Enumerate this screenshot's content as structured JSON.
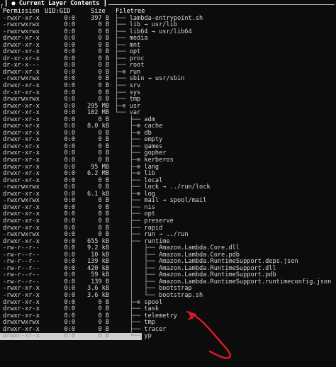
{
  "panel": {
    "title": "Current Layer Contents"
  },
  "columns": {
    "permission": "Permission",
    "uid_gid": "UID:GID",
    "size": "Size",
    "filetree": "Filetree"
  },
  "rows": [
    {
      "perm": "-rwxr-xr-x",
      "uid": "0:0",
      "size": "397 B",
      "tree": "├── ",
      "name": "lambda-entrypoint.sh"
    },
    {
      "perm": "-rwxrwxrwx",
      "uid": "0:0",
      "size": "0 B",
      "tree": "├── ",
      "name": "lib → usr/lib"
    },
    {
      "perm": "-rwxrwxrwx",
      "uid": "0:0",
      "size": "0 B",
      "tree": "├── ",
      "name": "lib64 → usr/lib64"
    },
    {
      "perm": "drwxr-xr-x",
      "uid": "0:0",
      "size": "0 B",
      "tree": "├── ",
      "name": "media"
    },
    {
      "perm": "drwxr-xr-x",
      "uid": "0:0",
      "size": "0 B",
      "tree": "├── ",
      "name": "mnt"
    },
    {
      "perm": "drwxr-xr-x",
      "uid": "0:0",
      "size": "0 B",
      "tree": "├── ",
      "name": "opt"
    },
    {
      "perm": "dr-xr-xr-x",
      "uid": "0:0",
      "size": "0 B",
      "tree": "├── ",
      "name": "proc"
    },
    {
      "perm": "dr-xr-x---",
      "uid": "0:0",
      "size": "0 B",
      "tree": "├── ",
      "name": "root"
    },
    {
      "perm": "drwxr-xr-x",
      "uid": "0:0",
      "size": "0 B",
      "tree": "├─⊕ ",
      "name": "run"
    },
    {
      "perm": "-rwxrwxrwx",
      "uid": "0:0",
      "size": "0 B",
      "tree": "├── ",
      "name": "sbin → usr/sbin"
    },
    {
      "perm": "drwxr-xr-x",
      "uid": "0:0",
      "size": "0 B",
      "tree": "├── ",
      "name": "srv"
    },
    {
      "perm": "dr-xr-xr-x",
      "uid": "0:0",
      "size": "0 B",
      "tree": "├── ",
      "name": "sys"
    },
    {
      "perm": "drwxrwxrwx",
      "uid": "0:0",
      "size": "0 B",
      "tree": "├── ",
      "name": "tmp"
    },
    {
      "perm": "drwxr-xr-x",
      "uid": "0:0",
      "size": "295 MB",
      "tree": "├─⊕ ",
      "name": "usr"
    },
    {
      "perm": "drwxr-xr-x",
      "uid": "0:0",
      "size": "102 MB",
      "tree": "└── ",
      "name": "var"
    },
    {
      "perm": "drwxr-xr-x",
      "uid": "0:0",
      "size": "0 B",
      "tree": "    ├── ",
      "name": "adm"
    },
    {
      "perm": "drwxr-xr-x",
      "uid": "0:0",
      "size": "8.0 kB",
      "tree": "    ├─⊕ ",
      "name": "cache"
    },
    {
      "perm": "drwxr-xr-x",
      "uid": "0:0",
      "size": "0 B",
      "tree": "    ├─⊕ ",
      "name": "db"
    },
    {
      "perm": "drwxr-xr-x",
      "uid": "0:0",
      "size": "0 B",
      "tree": "    ├── ",
      "name": "empty"
    },
    {
      "perm": "drwxr-xr-x",
      "uid": "0:0",
      "size": "0 B",
      "tree": "    ├── ",
      "name": "games"
    },
    {
      "perm": "drwxr-xr-x",
      "uid": "0:0",
      "size": "0 B",
      "tree": "    ├── ",
      "name": "gopher"
    },
    {
      "perm": "drwxr-xr-x",
      "uid": "0:0",
      "size": "0 B",
      "tree": "    ├─⊕ ",
      "name": "kerberos"
    },
    {
      "perm": "drwxr-xr-x",
      "uid": "0:0",
      "size": "95 MB",
      "tree": "    ├─⊕ ",
      "name": "lang"
    },
    {
      "perm": "drwxr-xr-x",
      "uid": "0:0",
      "size": "6.2 MB",
      "tree": "    ├─⊕ ",
      "name": "lib"
    },
    {
      "perm": "drwxr-xr-x",
      "uid": "0:0",
      "size": "0 B",
      "tree": "    ├── ",
      "name": "local"
    },
    {
      "perm": "-rwxrwxrwx",
      "uid": "0:0",
      "size": "0 B",
      "tree": "    ├── ",
      "name": "lock → ../run/lock"
    },
    {
      "perm": "drwxr-xr-x",
      "uid": "0:0",
      "size": "6.1 kB",
      "tree": "    ├─⊕ ",
      "name": "log"
    },
    {
      "perm": "-rwxrwxrwx",
      "uid": "0:0",
      "size": "0 B",
      "tree": "    ├── ",
      "name": "mail → spool/mail"
    },
    {
      "perm": "drwxr-xr-x",
      "uid": "0:0",
      "size": "0 B",
      "tree": "    ├── ",
      "name": "nis"
    },
    {
      "perm": "drwxr-xr-x",
      "uid": "0:0",
      "size": "0 B",
      "tree": "    ├── ",
      "name": "opt"
    },
    {
      "perm": "drwxr-xr-x",
      "uid": "0:0",
      "size": "0 B",
      "tree": "    ├── ",
      "name": "preserve"
    },
    {
      "perm": "drwxr-xr-x",
      "uid": "0:0",
      "size": "0 B",
      "tree": "    ├── ",
      "name": "rapid"
    },
    {
      "perm": "-rwxrwxrwx",
      "uid": "0:0",
      "size": "0 B",
      "tree": "    ├── ",
      "name": "run → ../run"
    },
    {
      "perm": "drwxr-xr-x",
      "uid": "0:0",
      "size": "655 kB",
      "tree": "    ├── ",
      "name": "runtime"
    },
    {
      "perm": "-rw-r--r--",
      "uid": "0:0",
      "size": "9.2 kB",
      "tree": "    │   ├── ",
      "name": "Amazon.Lambda.Core.dll"
    },
    {
      "perm": "-rw-r--r--",
      "uid": "0:0",
      "size": "10 kB",
      "tree": "    │   ├── ",
      "name": "Amazon.Lambda.Core.pdb"
    },
    {
      "perm": "-rw-r--r--",
      "uid": "0:0",
      "size": "139 kB",
      "tree": "    │   ├── ",
      "name": "Amazon.Lambda.RuntimeSupport.deps.json"
    },
    {
      "perm": "-rw-r--r--",
      "uid": "0:0",
      "size": "420 kB",
      "tree": "    │   ├── ",
      "name": "Amazon.Lambda.RuntimeSupport.dll"
    },
    {
      "perm": "-rw-r--r--",
      "uid": "0:0",
      "size": "59 kB",
      "tree": "    │   ├── ",
      "name": "Amazon.Lambda.RuntimeSupport.pdb"
    },
    {
      "perm": "-rw-r--r--",
      "uid": "0:0",
      "size": "139 B",
      "tree": "    │   ├── ",
      "name": "Amazon.Lambda.RuntimeSupport.runtimeconfig.json"
    },
    {
      "perm": "-rwxr-xr-x",
      "uid": "0:0",
      "size": "3.6 kB",
      "tree": "    │   ├── ",
      "name": "bootstrap"
    },
    {
      "perm": "-rwxr-xr-x",
      "uid": "0:0",
      "size": "3.6 kB",
      "tree": "    │   └── ",
      "name": "bootstrap.sh"
    },
    {
      "perm": "drwxr-xr-x",
      "uid": "0:0",
      "size": "0 B",
      "tree": "    ├─⊕ ",
      "name": "spool"
    },
    {
      "perm": "drwxr-xr-x",
      "uid": "0:0",
      "size": "0 B",
      "tree": "    ├── ",
      "name": "task"
    },
    {
      "perm": "drwxr-xr-x",
      "uid": "0:0",
      "size": "0 B",
      "tree": "    ├── ",
      "name": "telemetry"
    },
    {
      "perm": "drwxrwxrwx",
      "uid": "0:0",
      "size": "0 B",
      "tree": "    ├── ",
      "name": "tmp"
    },
    {
      "perm": "drwxr-xr-x",
      "uid": "0:0",
      "size": "0 B",
      "tree": "    ├── ",
      "name": "tracer"
    },
    {
      "perm": "drwxr-xr-x",
      "uid": "0:0",
      "size": "0 B",
      "tree": "    └── ",
      "name": "yp",
      "selected": true
    }
  ],
  "colors": {
    "background": "#0c0c0c",
    "text": "#d6d6d6",
    "annotation": "#e0182b",
    "selection": "#cfcfcf"
  }
}
